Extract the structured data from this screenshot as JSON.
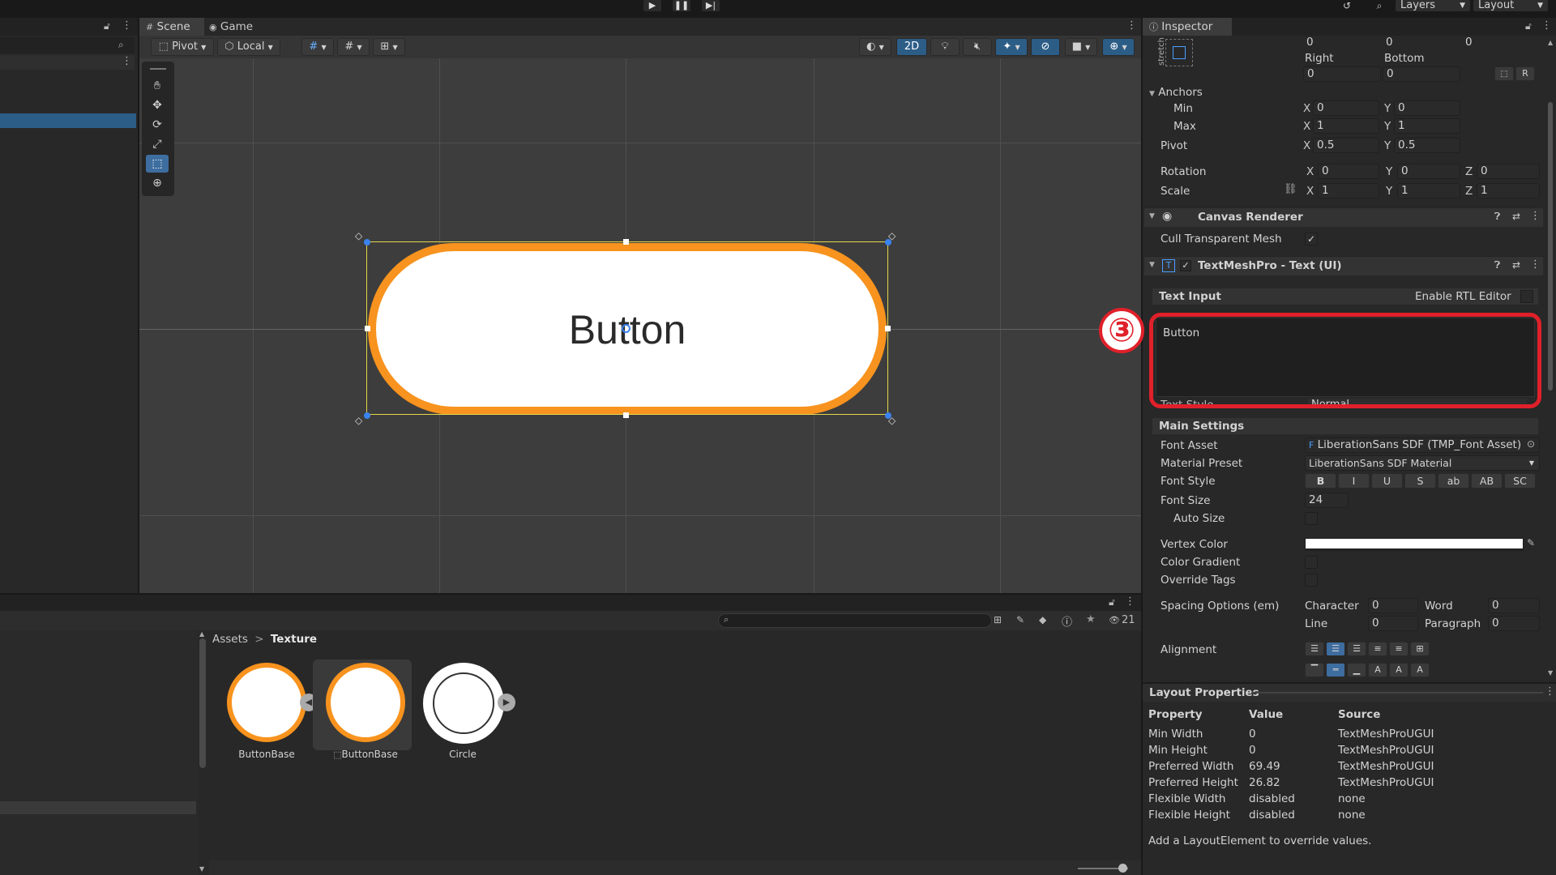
{
  "toolbar": {
    "layers": "Layers",
    "layout": "Layout"
  },
  "tabs": {
    "scene": "Scene",
    "game": "Game"
  },
  "scene_toolbar": {
    "pivot": "Pivot",
    "local": "Local",
    "mode_2d": "2D"
  },
  "scene": {
    "button_text": "Button"
  },
  "inspector": {
    "title": "Inspector",
    "stretch": "stretch",
    "rect": {
      "top_values": [
        "0",
        "0",
        "0"
      ],
      "right_label": "Right",
      "bottom_label": "Bottom",
      "right_value": "0",
      "bottom_value": "0",
      "r_btn": "R"
    },
    "anchors": {
      "label": "Anchors",
      "min_label": "Min",
      "max_label": "Max",
      "min_x": "0",
      "min_y": "0",
      "max_x": "1",
      "max_y": "1"
    },
    "pivot": {
      "label": "Pivot",
      "x": "0.5",
      "y": "0.5"
    },
    "rotation": {
      "label": "Rotation",
      "x": "0",
      "y": "0",
      "z": "0"
    },
    "scale": {
      "label": "Scale",
      "x": "1",
      "y": "1",
      "z": "1"
    },
    "axis": {
      "x": "X",
      "y": "Y",
      "z": "Z"
    },
    "canvas_renderer": {
      "title": "Canvas Renderer",
      "cull_label": "Cull Transparent Mesh",
      "cull_checked": true
    },
    "tmp": {
      "title": "TextMeshPro - Text (UI)",
      "text_input_label": "Text Input",
      "rtl_label": "Enable RTL Editor",
      "text_value": "Button",
      "text_style_label": "Text Style",
      "text_style_value": "Normal",
      "annotation": "③",
      "main_settings": "Main Settings",
      "font_asset_label": "Font Asset",
      "font_asset_value": "LiberationSans SDF (TMP_Font Asset)",
      "material_preset_label": "Material Preset",
      "material_preset_value": "LiberationSans SDF Material",
      "font_style_label": "Font Style",
      "font_style_buttons": [
        "B",
        "I",
        "U",
        "S",
        "ab",
        "AB",
        "SC"
      ],
      "font_size_label": "Font Size",
      "font_size_value": "24",
      "auto_size_label": "Auto Size",
      "vertex_color_label": "Vertex Color",
      "color_gradient_label": "Color Gradient",
      "override_tags_label": "Override Tags",
      "spacing_label": "Spacing Options (em)",
      "character_label": "Character",
      "character_value": "0",
      "word_label": "Word",
      "word_value": "0",
      "line_label": "Line",
      "line_value": "0",
      "paragraph_label": "Paragraph",
      "paragraph_value": "0",
      "alignment_label": "Alignment"
    }
  },
  "layout_properties": {
    "title": "Layout Properties",
    "headers": [
      "Property",
      "Value",
      "Source"
    ],
    "rows": [
      [
        "Min Width",
        "0",
        "TextMeshProUGUI"
      ],
      [
        "Min Height",
        "0",
        "TextMeshProUGUI"
      ],
      [
        "Preferred Width",
        "69.49",
        "TextMeshProUGUI"
      ],
      [
        "Preferred Height",
        "26.82",
        "TextMeshProUGUI"
      ],
      [
        "Flexible Width",
        "disabled",
        "none"
      ],
      [
        "Flexible Height",
        "disabled",
        "none"
      ]
    ],
    "footer": "Add a LayoutElement to override values."
  },
  "project": {
    "breadcrumb_root": "Assets",
    "breadcrumb_sep": ">",
    "breadcrumb_current": "Texture",
    "visible_count": "21",
    "assets": [
      {
        "name": "ButtonBase"
      },
      {
        "name": "ButtonBase"
      },
      {
        "name": "Circle"
      }
    ]
  },
  "colors": {
    "accent_orange": "#f7931e",
    "highlight_red": "#e0202a",
    "selection_blue": "#2c5d87",
    "rect_yellow": "#e6d84a"
  }
}
